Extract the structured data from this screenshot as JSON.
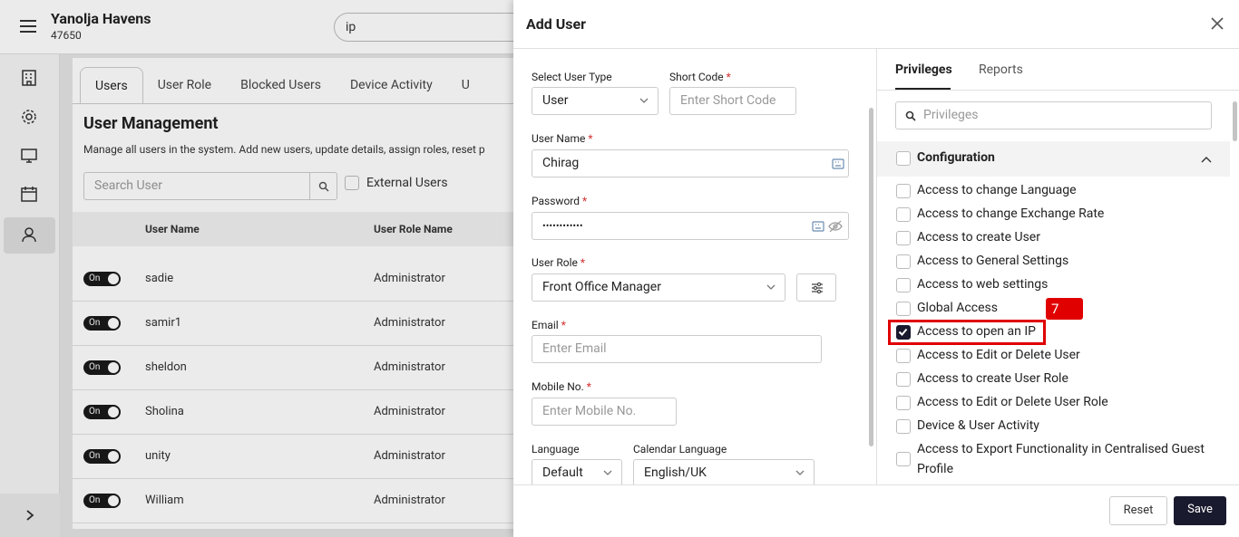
{
  "header": {
    "hotel_name": "Yanolja Havens",
    "hotel_code": "47650",
    "search_value": "ip"
  },
  "tabs": [
    "Users",
    "User Role",
    "Blocked Users",
    "Device Activity",
    "U"
  ],
  "page": {
    "title": "User Management",
    "description": "Manage all users in the system. Add new users, update details, assign roles, reset p",
    "search_placeholder": "Search User",
    "external_users_label": "External Users",
    "columns": {
      "user_name": "User Name",
      "user_role_name": "User Role Name"
    }
  },
  "users": [
    {
      "toggle": "On",
      "name": "sadie",
      "role": "Administrator"
    },
    {
      "toggle": "On",
      "name": "samir1",
      "role": "Administrator"
    },
    {
      "toggle": "On",
      "name": "sheldon",
      "role": "Administrator"
    },
    {
      "toggle": "On",
      "name": "Sholina",
      "role": "Administrator"
    },
    {
      "toggle": "On",
      "name": "unity",
      "role": "Administrator"
    },
    {
      "toggle": "On",
      "name": "William",
      "role": "Administrator"
    }
  ],
  "modal": {
    "title": "Add User",
    "user_type_label": "Select User Type",
    "user_type_value": "User",
    "short_code_label": "Short Code",
    "short_code_placeholder": "Enter Short Code",
    "user_name_label": "User Name",
    "user_name_value": "Chirag",
    "password_label": "Password",
    "password_value": "••••••••••••",
    "user_role_label": "User Role",
    "user_role_value": "Front Office Manager",
    "email_label": "Email",
    "email_placeholder": "Enter Email",
    "mobile_label": "Mobile No.",
    "mobile_placeholder": "Enter Mobile No.",
    "language_label": "Language",
    "language_value": "Default",
    "calendar_language_label": "Calendar Language",
    "calendar_language_value": "English/UK",
    "required_mark": "*",
    "tab_privileges": "Privileges",
    "tab_reports": "Reports",
    "privileges_placeholder": "Privileges",
    "section_title": "Configuration",
    "privileges": [
      {
        "label": "Access to change Language",
        "checked": false
      },
      {
        "label": "Access to change Exchange Rate",
        "checked": false
      },
      {
        "label": "Access to create User",
        "checked": false
      },
      {
        "label": "Access to General Settings",
        "checked": false
      },
      {
        "label": "Access to web settings",
        "checked": false
      },
      {
        "label": "Global Access",
        "checked": false
      },
      {
        "label": "Access to open an IP",
        "checked": true
      },
      {
        "label": "Access to Edit or Delete User",
        "checked": false
      },
      {
        "label": "Access to create User Role",
        "checked": false
      },
      {
        "label": "Access to Edit or Delete User Role",
        "checked": false
      },
      {
        "label": "Device & User Activity",
        "checked": false
      },
      {
        "label": "Access to Export Functionality in Centralised Guest",
        "checked": false
      },
      {
        "label": "Profile",
        "checked": false
      }
    ],
    "reset_label": "Reset",
    "save_label": "Save"
  },
  "annotation": {
    "step_number": "7",
    "color": "#e00000"
  },
  "colors": {
    "primary": "#1a1a2e",
    "highlight": "#e00000"
  }
}
